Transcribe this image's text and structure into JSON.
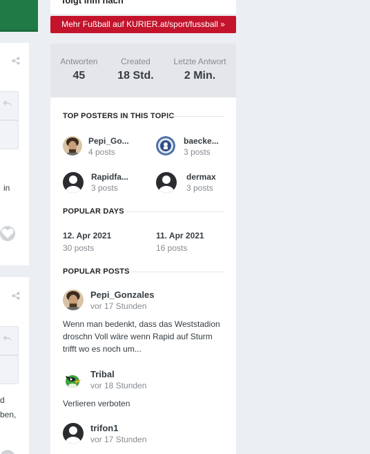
{
  "promo": {
    "headline": "folgt ihm nach",
    "button": "Mehr Fußball auf KURIER.at/sport/fussball »"
  },
  "stats": [
    {
      "label": "Antworten",
      "value": "45"
    },
    {
      "label": "Created",
      "value": "18 Std."
    },
    {
      "label": "Letzte Antwort",
      "value": "2 Min."
    }
  ],
  "top_posters": {
    "title": "TOP POSTERS IN THIS TOPIC",
    "items": [
      {
        "name": "Pepi_Go...",
        "count": "4 posts",
        "avatar": "face-avatar"
      },
      {
        "name": "baecke...",
        "count": "3 posts",
        "avatar": "club-badge-avatar"
      },
      {
        "name": "Rapidfa...",
        "count": "3 posts",
        "avatar": "default-avatar"
      },
      {
        "name": "dermax",
        "count": "3 posts",
        "avatar": "default-avatar"
      }
    ]
  },
  "popular_days": {
    "title": "POPULAR DAYS",
    "items": [
      {
        "date": "12. Apr 2021",
        "count": "30 posts"
      },
      {
        "date": "11. Apr 2021",
        "count": "16 posts"
      }
    ]
  },
  "popular_posts": {
    "title": "POPULAR POSTS",
    "items": [
      {
        "author": "Pepi_Gonzales",
        "time": "vor 17 Stunden",
        "excerpt": "Wenn man bedenkt, dass das Weststadion droschn Voll wäre wenn Rapid auf Sturm trifft wo es noch um...",
        "avatar": "face-avatar"
      },
      {
        "author": "Tribal",
        "time": "vor 18 Stunden",
        "excerpt": "Verlieren verboten",
        "avatar": "bird-avatar"
      },
      {
        "author": "trifon1",
        "time": "vor 17 Stunden",
        "excerpt": "",
        "avatar": "default-avatar"
      }
    ]
  },
  "left_column": {
    "fragment1": "in",
    "fragment2": "d",
    "fragment3": "ben,"
  },
  "colors": {
    "brand_green": "#1f7a45",
    "promo_red": "#c3142c",
    "stats_bg": "#e4e6e9",
    "muted_text": "#858a90"
  }
}
